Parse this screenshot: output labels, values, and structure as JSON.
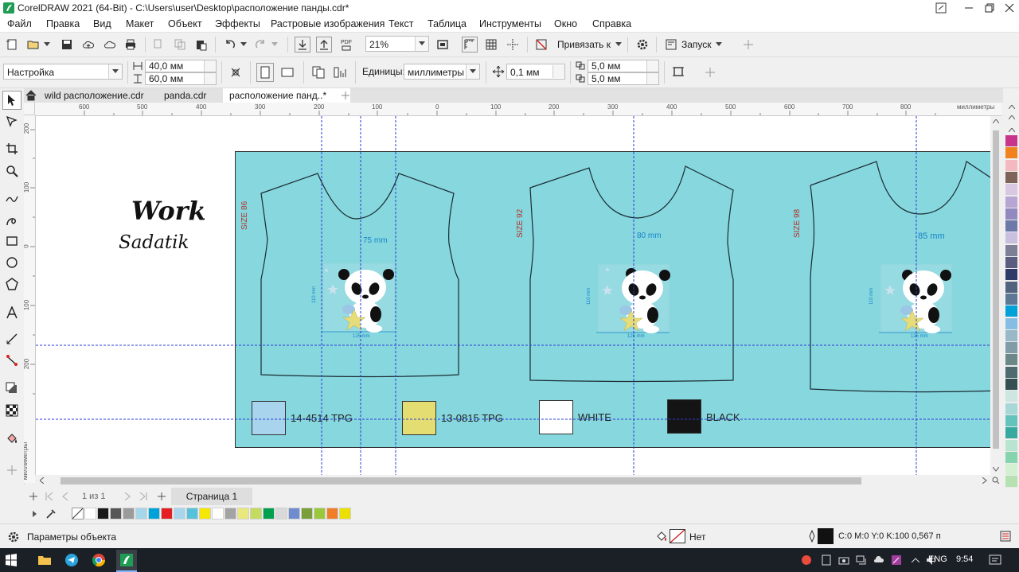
{
  "window": {
    "title": "CorelDRAW 2021 (64-Bit) - C:\\Users\\user\\Desktop\\расположение панды.cdr*",
    "controls": [
      "minimize",
      "restore",
      "close"
    ]
  },
  "menu": {
    "items": [
      {
        "label": "Файл",
        "mnemonic": "Ф"
      },
      {
        "label": "Правка",
        "mnemonic": "П"
      },
      {
        "label": "Вид",
        "mnemonic": "В"
      },
      {
        "label": "Макет",
        "mnemonic": "М"
      },
      {
        "label": "Объект",
        "mnemonic": "О"
      },
      {
        "label": "Эффекты",
        "mnemonic": "Э"
      },
      {
        "label": "Растровые изображения",
        "mnemonic": "Р"
      },
      {
        "label": "Текст",
        "mnemonic": "Т"
      },
      {
        "label": "Таблица",
        "mnemonic": "Т"
      },
      {
        "label": "Инструменты",
        "mnemonic": "И"
      },
      {
        "label": "Окно",
        "mnemonic": "О"
      },
      {
        "label": "Справка",
        "mnemonic": "С"
      }
    ]
  },
  "standard_toolbar": {
    "zoom": "21%",
    "snap_label": "Привязать к",
    "launch_label": "Запуск"
  },
  "property_bar": {
    "preset": "Настройка",
    "width": "40,0 мм",
    "height": "60,0 мм",
    "units_label": "Единицы:",
    "units": "миллиметры",
    "nudge": "0,1 мм",
    "dup_x": "5,0 мм",
    "dup_y": "5,0 мм"
  },
  "doc_tabs": [
    {
      "label": "wild расположение.cdr",
      "active": false
    },
    {
      "label": "panda.cdr",
      "active": false
    },
    {
      "label": "расположение панд..*",
      "active": true
    }
  ],
  "rulers": {
    "unit_label": "миллиметры",
    "h_ticks": [
      "600",
      "500",
      "400",
      "300",
      "200",
      "100",
      "0",
      "100",
      "200",
      "300",
      "400",
      "500",
      "600",
      "700",
      "800"
    ],
    "v_ticks": [
      "200",
      "100",
      "0",
      "100",
      "200"
    ]
  },
  "artwork": {
    "signature_line1": "Work",
    "signature_line2": "Sadatik",
    "shirts": [
      {
        "size": "SIZE 86",
        "width_dim": "75 mm",
        "height_dim": "110 mm",
        "base_dim": "125 mm"
      },
      {
        "size": "SIZE 92",
        "width_dim": "80 mm",
        "height_dim": "110 mm",
        "base_dim": "125 mm"
      },
      {
        "size": "SIZE 98",
        "width_dim": "85 mm",
        "height_dim": "110 mm",
        "base_dim": "125 mm"
      }
    ],
    "swatches": [
      {
        "label": "14-4514 TPG",
        "color": "#a9d4ee"
      },
      {
        "label": "13-0815 TPG",
        "color": "#e3dd72"
      },
      {
        "label": "WHITE",
        "color": "#ffffff"
      },
      {
        "label": "BLACK",
        "color": "#141414"
      }
    ],
    "background_color": "#86d7de"
  },
  "page_nav": {
    "page_count": "1 из 1",
    "page_tab": "Страница 1"
  },
  "status": {
    "object_props": "Параметры объекта",
    "fill_none": "Нет",
    "outline": "C:0 M:0 Y:0 K:100  0,567 п"
  },
  "taskbar": {
    "language": "ENG",
    "time": "9:54"
  },
  "palette": {
    "bottom": [
      "#ffffff",
      "#1a1a1a",
      "#575757",
      "#9b9b9b",
      "#a6d6ea",
      "#00a3d9",
      "#e31e24",
      "#a9d4ee",
      "#55c2dc",
      "#f4e800",
      "#ffffff",
      "#a3a3a3",
      "#e9e87c",
      "#c4dc5e",
      "#00a04f",
      "#d9d9d9",
      "#6f8ccf",
      "#7a9e3a",
      "#99c93a",
      "#f07e26",
      "#ece000"
    ],
    "right": [
      "#c8348c",
      "#f0831e",
      "#f4b8c0",
      "#7d6358",
      "#d9c8e2",
      "#b7a6d3",
      "#9289be",
      "#6c79a9",
      "#c9c0e0",
      "#7d7f97",
      "#5a5d80",
      "#2f3a68",
      "#51637d",
      "#5c7895",
      "#00a1d9",
      "#86bde2",
      "#9ab9c8",
      "#7f9ca7",
      "#6c8788",
      "#4e6c6f",
      "#364f53",
      "#cde6e2",
      "#a7d7d6",
      "#64c4bd",
      "#38a99e",
      "#b9e4d0",
      "#86d4ae",
      "#d5efd2",
      "#b5e2b0"
    ]
  }
}
